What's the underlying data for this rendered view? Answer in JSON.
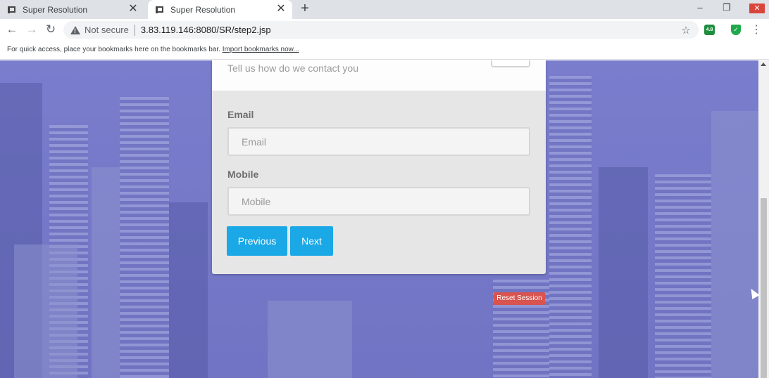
{
  "browser": {
    "tabs": [
      {
        "title": "Super Resolution",
        "active": false
      },
      {
        "title": "Super Resolution",
        "active": true
      }
    ],
    "new_tab_icon": "+",
    "window_controls": {
      "minimize": "–",
      "maximize": "❐",
      "close": "✕"
    },
    "nav": {
      "back": "←",
      "forward": "→",
      "reload": "↻"
    },
    "security_label": "Not secure",
    "url": "3.83.119.146:8080/SR/step2.jsp",
    "star_icon": "☆",
    "extensions": {
      "ext1": "4.8",
      "ext2": "✓"
    },
    "menu_icon": "⋮"
  },
  "bookmarks_bar": {
    "text": "For quick access, place your bookmarks here on the bookmarks bar.",
    "link": "Import bookmarks now..."
  },
  "form": {
    "subtitle": "Tell us how do we contact you",
    "email": {
      "label": "Email",
      "placeholder": "Email",
      "value": ""
    },
    "mobile": {
      "label": "Mobile",
      "placeholder": "Mobile",
      "value": ""
    },
    "previous_label": "Previous",
    "next_label": "Next"
  },
  "reset_session_label": "Reset Session",
  "colors": {
    "accent": "#1aa8e6",
    "danger": "#d9534f",
    "background_tint": "#6e72c8"
  }
}
